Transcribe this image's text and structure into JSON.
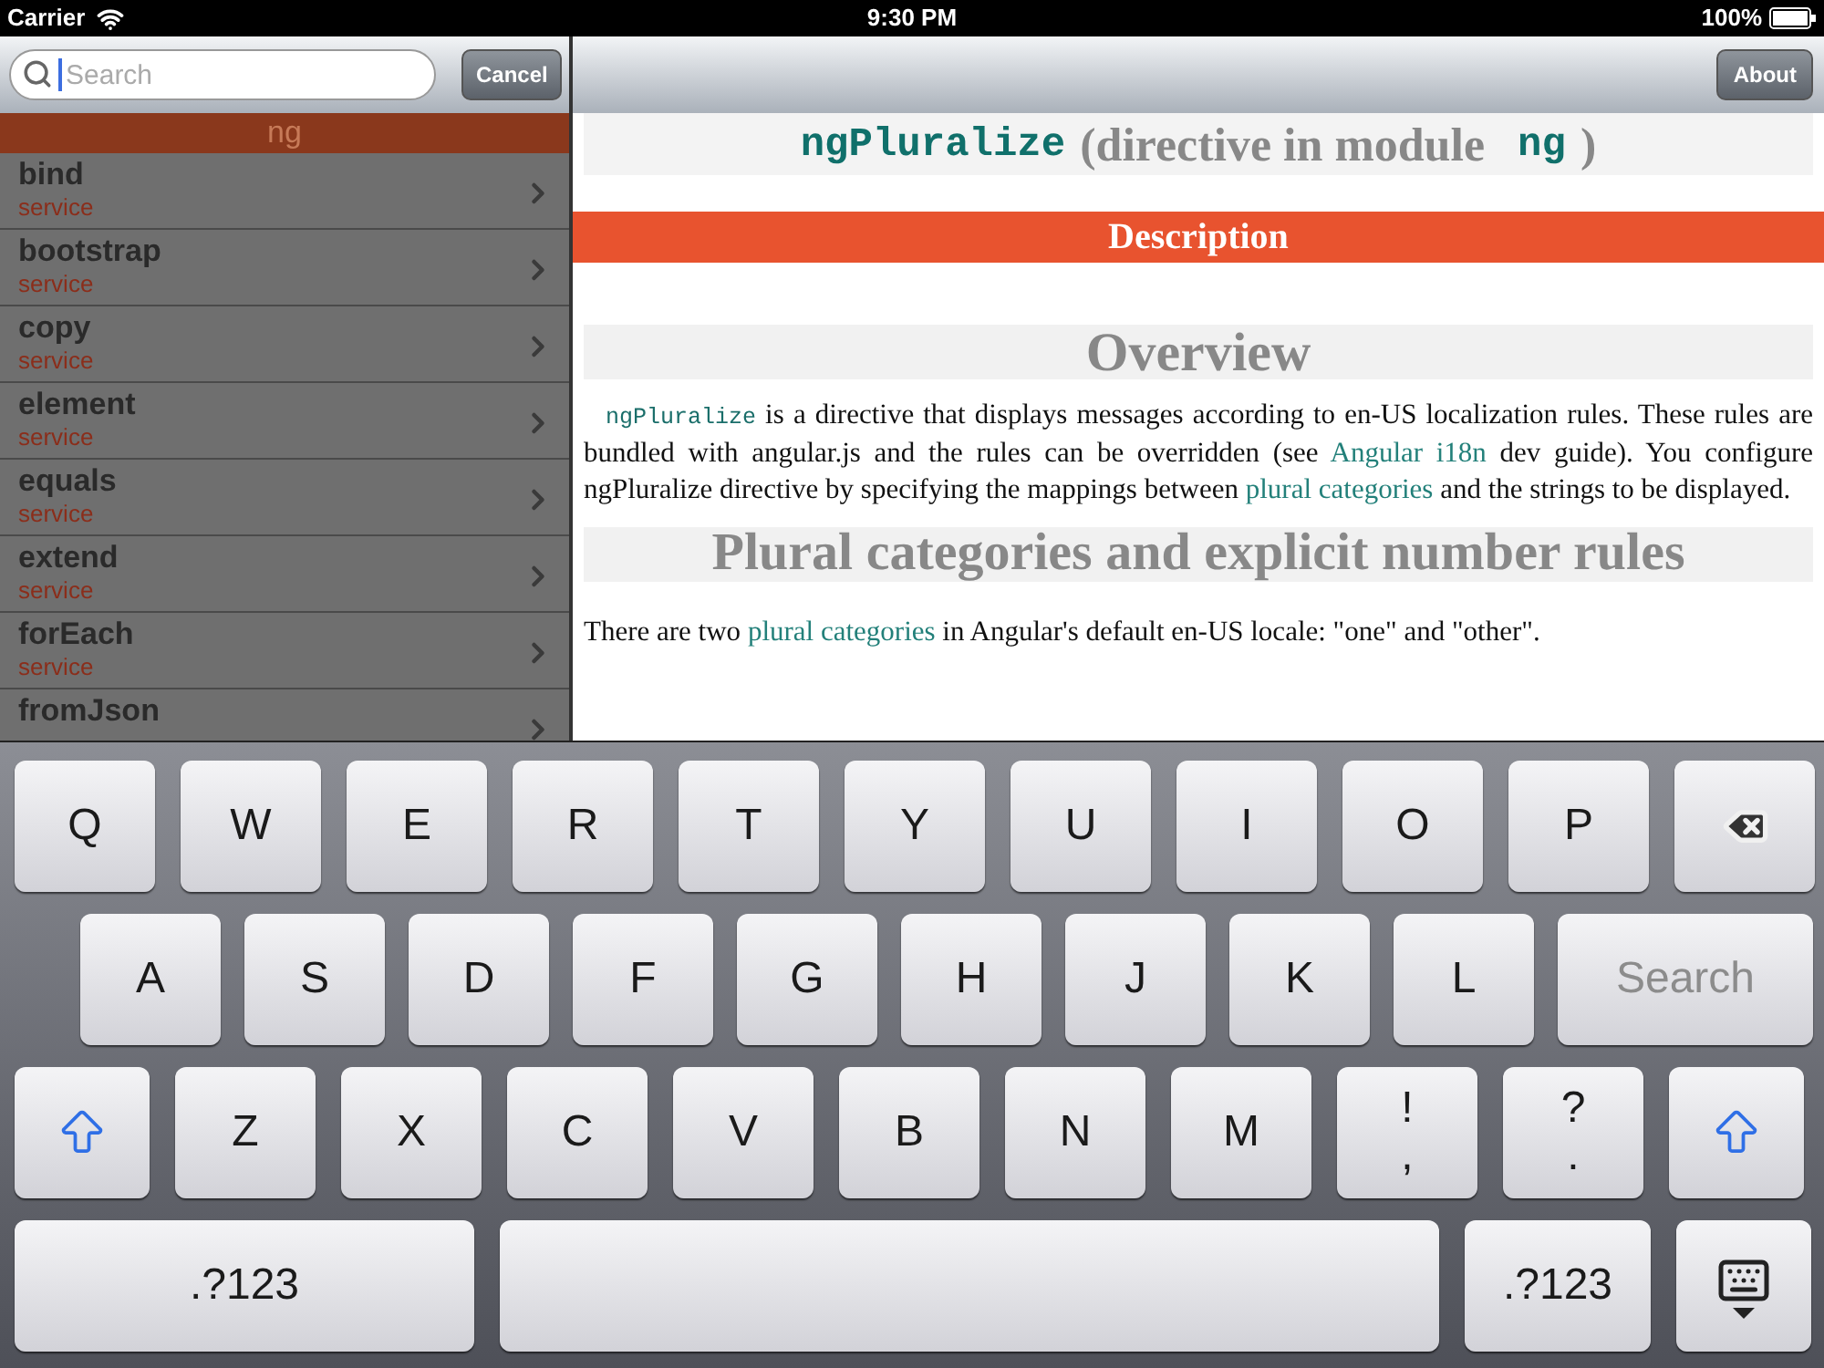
{
  "status_bar": {
    "carrier": "Carrier",
    "time": "9:30 PM",
    "battery": "100%"
  },
  "sidebar": {
    "search": {
      "placeholder": "Search"
    },
    "cancel_button": "Cancel",
    "section_header": "ng",
    "items": [
      {
        "name": "bind",
        "type": "service"
      },
      {
        "name": "bootstrap",
        "type": "service"
      },
      {
        "name": "copy",
        "type": "service"
      },
      {
        "name": "element",
        "type": "service"
      },
      {
        "name": "equals",
        "type": "service"
      },
      {
        "name": "extend",
        "type": "service"
      },
      {
        "name": "forEach",
        "type": "service"
      },
      {
        "name": "fromJson"
      }
    ]
  },
  "content": {
    "about_button": "About",
    "title": {
      "name": "ngPluralize",
      "text": "(directive in module",
      "module": "ng",
      "close": ")"
    },
    "description_heading": "Description",
    "overview_heading": "Overview",
    "overview_paragraph": [
      {
        "kind": "code",
        "text": "ngPluralize"
      },
      {
        "kind": "text",
        "text": " is a directive that displays messages according to en-US localization rules. These rules are bundled with angular.js and the rules can be overridden (see "
      },
      {
        "kind": "link",
        "text": "Angular i18n"
      },
      {
        "kind": "text",
        "text": " dev guide). You configure ngPluralize directive by specifying the mappings between "
      },
      {
        "kind": "link",
        "text": "plural categories"
      },
      {
        "kind": "text",
        "text": " and the strings to be displayed."
      }
    ],
    "plural_heading": "Plural categories and explicit number rules",
    "plural_paragraph": [
      {
        "kind": "text",
        "text": "There are two "
      },
      {
        "kind": "link",
        "text": "plural categories"
      },
      {
        "kind": "text",
        "text": " in Angular's default en-US locale: \"one\" and \"other\"."
      }
    ]
  },
  "keyboard": {
    "rows": [
      {
        "keys": [
          {
            "kind": "letter",
            "label": "Q"
          },
          {
            "kind": "letter",
            "label": "W"
          },
          {
            "kind": "letter",
            "label": "E"
          },
          {
            "kind": "letter",
            "label": "R"
          },
          {
            "kind": "letter",
            "label": "T"
          },
          {
            "kind": "letter",
            "label": "Y"
          },
          {
            "kind": "letter",
            "label": "U"
          },
          {
            "kind": "letter",
            "label": "I"
          },
          {
            "kind": "letter",
            "label": "O"
          },
          {
            "kind": "letter",
            "label": "P"
          },
          {
            "kind": "backspace"
          }
        ]
      },
      {
        "keys": [
          {
            "kind": "letter",
            "label": "A"
          },
          {
            "kind": "letter",
            "label": "S"
          },
          {
            "kind": "letter",
            "label": "D"
          },
          {
            "kind": "letter",
            "label": "F"
          },
          {
            "kind": "letter",
            "label": "G"
          },
          {
            "kind": "letter",
            "label": "H"
          },
          {
            "kind": "letter",
            "label": "J"
          },
          {
            "kind": "letter",
            "label": "K"
          },
          {
            "kind": "letter",
            "label": "L"
          },
          {
            "kind": "search",
            "label": "Search"
          }
        ]
      },
      {
        "keys": [
          {
            "kind": "shift"
          },
          {
            "kind": "letter",
            "label": "Z"
          },
          {
            "kind": "letter",
            "label": "X"
          },
          {
            "kind": "letter",
            "label": "C"
          },
          {
            "kind": "letter",
            "label": "V"
          },
          {
            "kind": "letter",
            "label": "B"
          },
          {
            "kind": "letter",
            "label": "N"
          },
          {
            "kind": "letter",
            "label": "M"
          },
          {
            "kind": "dual",
            "label": "!",
            "sub": ","
          },
          {
            "kind": "dual",
            "label": "?",
            "sub": "."
          },
          {
            "kind": "shift"
          }
        ]
      },
      {
        "keys": [
          {
            "kind": "numbers",
            "label": ".?123"
          },
          {
            "kind": "space"
          },
          {
            "kind": "numbers_small",
            "label": ".?123"
          },
          {
            "kind": "hide"
          }
        ]
      }
    ]
  }
}
